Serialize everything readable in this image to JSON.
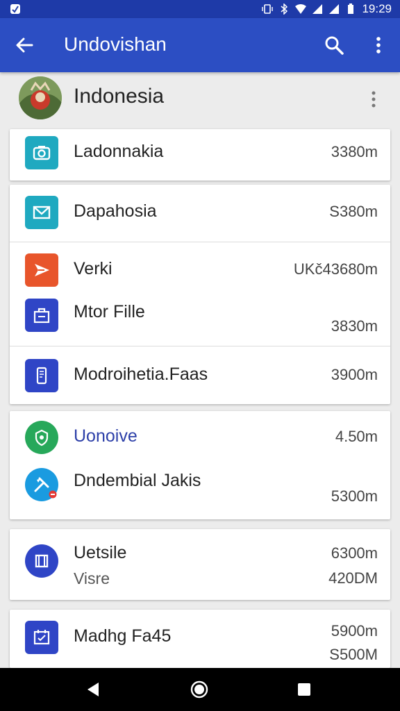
{
  "status_bar": {
    "time": "19:29",
    "icons": [
      "notification-icon",
      "vibrate-icon",
      "bluetooth-icon",
      "wifi-icon",
      "signal-icon",
      "signal-icon",
      "battery-icon"
    ]
  },
  "app_bar": {
    "title": "Undovishan",
    "icons": [
      "back-arrow-icon",
      "search-icon",
      "more-vert-icon"
    ]
  },
  "account": {
    "name": "Indonesia",
    "avatar_icon": "avatar-photo"
  },
  "cards": [
    {
      "rows": [
        {
          "label": "Ladonnakia",
          "size": "3380m",
          "icon": "camera-app-icon",
          "color": "#1fa9c0"
        }
      ]
    },
    {
      "rows": [
        {
          "label": "Dapahosia",
          "size": "S380m",
          "icon": "mail-app-icon",
          "color": "#1fa9c0"
        },
        {
          "label": "Verki",
          "size": "UKč43680m",
          "icon": "send-app-icon",
          "color": "#e8552b"
        },
        {
          "label": "Mtor Fille",
          "size": "3830m",
          "icon": "bag-app-icon",
          "color": "#2f45c6"
        },
        {
          "label": "Modroihetia.Faas",
          "size": "3900m",
          "icon": "phone-app-icon",
          "color": "#2f45c6"
        }
      ]
    },
    {
      "rows": [
        {
          "label": "Uonoive",
          "size": "4.50m",
          "icon": "shield-app-icon",
          "color": "#27a85a",
          "label_color": "#2c3fa8"
        },
        {
          "label": "Dndembial Jakis",
          "size": "5300m",
          "icon": "tools-app-icon",
          "color": "#1a9be0"
        }
      ]
    },
    {
      "rows": [
        {
          "label": "Uetsile",
          "sublabel": "Visre",
          "size": "6300m",
          "size2": "420DM",
          "icon": "book-app-icon",
          "color": "#2f45c6"
        }
      ]
    },
    {
      "rows": [
        {
          "label": "Madhg Fa45",
          "size": "5900m",
          "size2": "S500M",
          "icon": "calendar-app-icon",
          "color": "#2f45c6"
        }
      ]
    }
  ],
  "nav_bar": {
    "icons": [
      "nav-back-icon",
      "nav-home-icon",
      "nav-recents-icon"
    ]
  }
}
